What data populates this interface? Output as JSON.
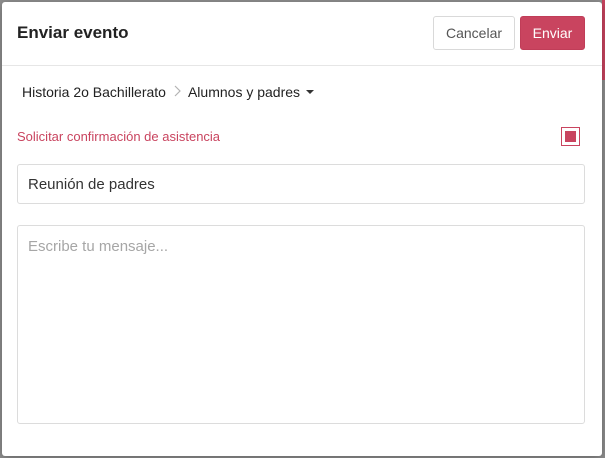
{
  "modal": {
    "title": "Enviar evento",
    "cancel_label": "Cancelar",
    "send_label": "Enviar"
  },
  "breadcrumb": {
    "group": "Historia 2o Bachillerato",
    "separator_icon": "chevron-right-icon",
    "audience": "Alumnos y padres",
    "audience_icon": "caret-down-icon"
  },
  "confirmation": {
    "label": "Solicitar confirmación de asistencia",
    "checked": true
  },
  "subject": {
    "value": "Reunión de padres"
  },
  "message": {
    "value": "",
    "placeholder": "Escribe tu mensaje..."
  },
  "colors": {
    "accent": "#c9445f",
    "border": "#dcdcdc",
    "text": "#222222"
  }
}
